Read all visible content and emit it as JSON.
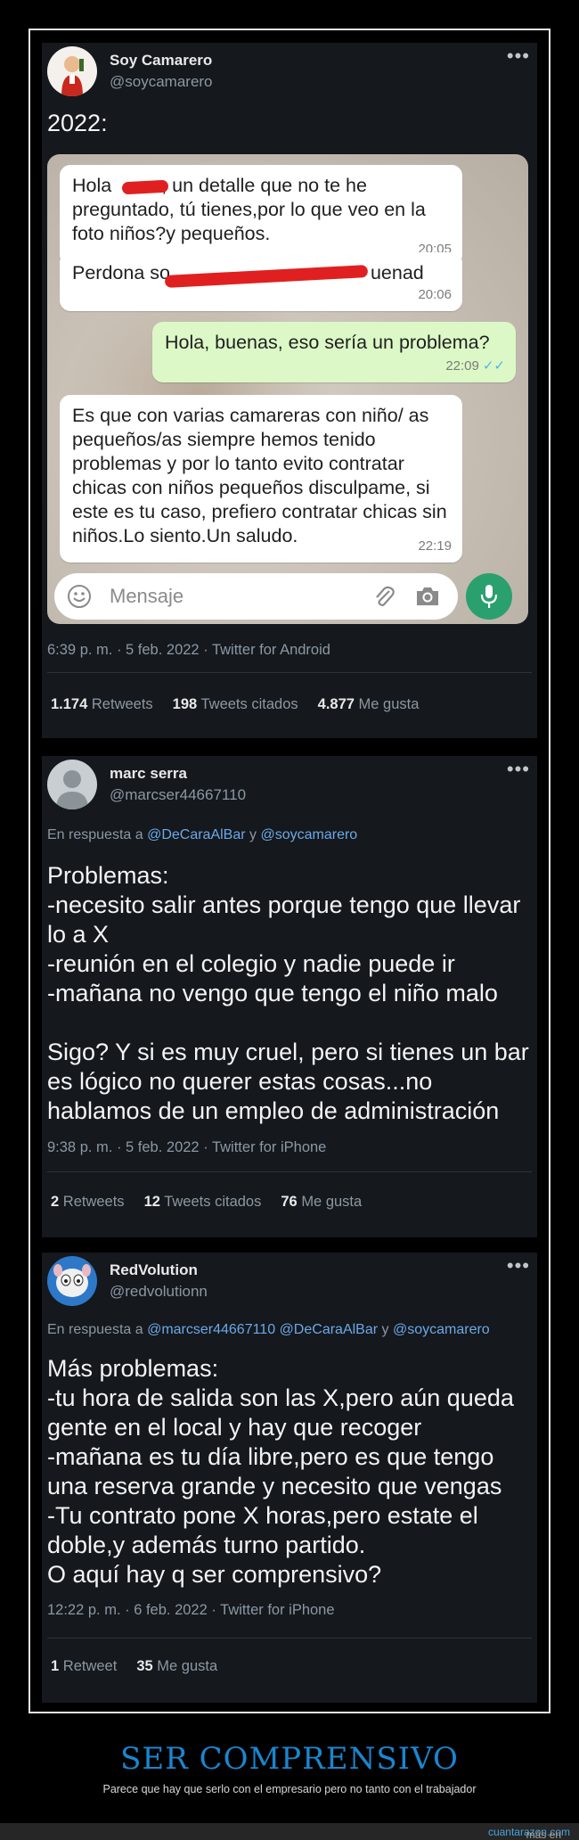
{
  "tweet1": {
    "name": "Soy Camarero",
    "handle": "@soycamarero",
    "text": "2022:",
    "chat": {
      "msg1_text": "Hola ██, un detalle que no te he preguntado, tú tienes,por lo que veo en la foto niños?y pequeños.",
      "msg1_part_a": "Hola ",
      "msg1_part_b": ", un detalle que no te he preguntado, tú tienes,por lo que veo en la foto niños?y pequeños.",
      "msg1_time": "20:05",
      "msg2_part_a": "Perdona so",
      "msg2_part_b": "uenad",
      "msg2_time": "20:06",
      "msg3_text": "Hola, buenas, eso sería un problema?",
      "msg3_time": "22:09",
      "msg4_text": "Es que con varias camareras con niño/ as pequeños/as siempre hemos tenido problemas y por lo tanto evito contratar chicas con niños pequeños disculpame, si este es tu caso, prefiero contratar chicas sin niños.Lo siento.Un saludo.",
      "msg4_time": "22:19",
      "input_placeholder": "Mensaje"
    },
    "meta": "6:39 p. m. · 5 feb. 2022 · Twitter for Android",
    "stats": {
      "retweets_count": "1.174",
      "retweets_label": "Retweets",
      "quotes_count": "198",
      "quotes_label": "Tweets citados",
      "likes_count": "4.877",
      "likes_label": "Me gusta"
    }
  },
  "tweet2": {
    "name": "marc serra",
    "handle": "@marcser44667110",
    "reply_prefix": "En respuesta a",
    "reply_user1": "@DeCaraAlBar",
    "reply_and": "y",
    "reply_user2": "@soycamarero",
    "text": "Problemas:\n-necesito salir antes porque tengo que llevar lo a X\n-reunión en el colegio y nadie puede ir\n-mañana no vengo que tengo el niño malo\n\nSigo? Y si es muy cruel, pero si tienes un bar es lógico no querer estas cosas...no hablamos de un empleo de administración",
    "meta": "9:38 p. m. · 5 feb. 2022 · Twitter for iPhone",
    "stats": {
      "retweets_count": "2",
      "retweets_label": "Retweets",
      "quotes_count": "12",
      "quotes_label": "Tweets citados",
      "likes_count": "76",
      "likes_label": "Me gusta"
    }
  },
  "tweet3": {
    "name": "RedVolution",
    "handle": "@redvolutionn",
    "reply_prefix": "En respuesta a",
    "reply_user1": "@marcser44667110",
    "reply_user2": "@DeCaraAlBar",
    "reply_and": "y",
    "reply_user3": "@soycamarero",
    "text": "Más problemas:\n-tu hora de salida son las X,pero aún queda gente en el local y hay que recoger\n-mañana es tu día libre,pero es que tengo una reserva grande y necesito que vengas\n-Tu contrato pone X horas,pero estate el doble,y además turno partido.\nO aquí hay q ser comprensivo?",
    "meta": "12:22 p. m. · 6 feb. 2022 · Twitter for iPhone",
    "stats": {
      "retweets_count": "1",
      "retweets_label": "Retweet",
      "likes_count": "35",
      "likes_label": "Me gusta"
    }
  },
  "footer": {
    "title": "SER COMPRENSIVO",
    "subtitle": "Parece que hay que serlo con el empresario pero no tanto con el trabajador",
    "more_prefix": "más en",
    "more_link": "cuantarazon.com"
  },
  "colors": {
    "tweet_bg": "#15181c",
    "link_blue": "#6aa9e9",
    "footer_title": "#1a86cf",
    "whatsapp_green": "#2aa06e",
    "bubble_out": "#dcf8c6"
  }
}
